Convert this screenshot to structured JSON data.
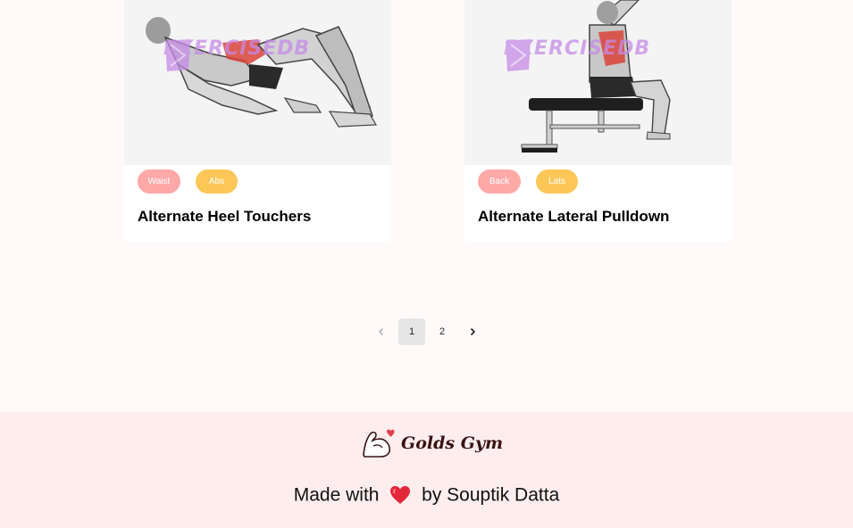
{
  "cards": [
    {
      "title": "Alternate Heel Touchers",
      "tags": [
        "Waist",
        "Abs"
      ],
      "watermark": "EXERCISEDB"
    },
    {
      "title": "Alternate Lateral Pulldown",
      "tags": [
        "Back",
        "Lats"
      ],
      "watermark": "EXERCISEDB"
    }
  ],
  "pagination": {
    "prev_icon": "chevron-left-icon",
    "next_icon": "chevron-right-icon",
    "pages": [
      "1",
      "2"
    ],
    "current": "1"
  },
  "footer": {
    "brand": "Golds Gym",
    "made_with_prefix": "Made with",
    "made_with_suffix": "by Souptik Datta",
    "heart_icon": "heart-icon"
  },
  "colors": {
    "page_bg": "#fff9f9",
    "footer_bg": "#fdeeed",
    "tag_primary": "#ffa8a8",
    "tag_secondary": "#fcc757",
    "watermark": "#c58be6"
  }
}
